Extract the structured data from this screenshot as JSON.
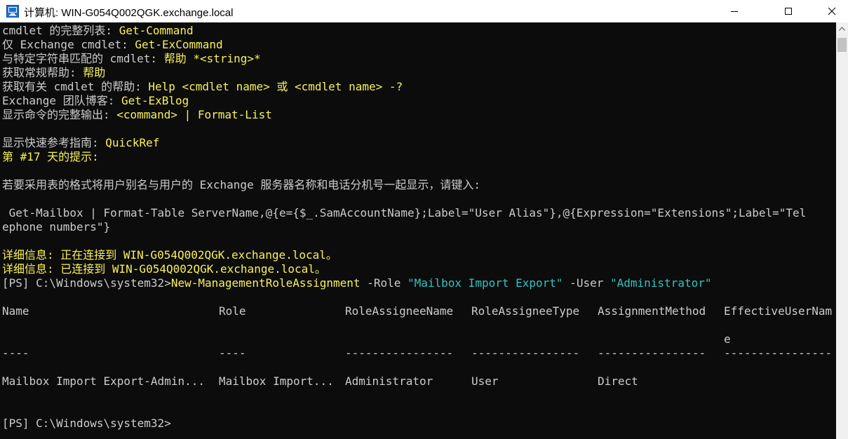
{
  "window": {
    "title": "计算机: WIN-G054Q002QGK.exchange.local",
    "minimize_icon": "minimize-icon",
    "maximize_icon": "maximize-icon",
    "close_icon": "close-icon"
  },
  "console": {
    "lines": [
      {
        "label": "cmdlet 的完整列表: ",
        "value": "Get-Command"
      },
      {
        "label": "仅 Exchange cmdlet: ",
        "value": "Get-ExCommand"
      },
      {
        "label": "与特定字符串匹配的 cmdlet: ",
        "value": "帮助 *<string>*"
      },
      {
        "label": "获取常规帮助: ",
        "value": "帮助"
      },
      {
        "label": "获取有关 cmdlet 的帮助: ",
        "value": "Help <cmdlet name> 或 <cmdlet name> -?"
      },
      {
        "label": "Exchange 团队博客: ",
        "value": "Get-ExBlog"
      },
      {
        "label": "显示命令的完整输出: ",
        "value": "<command> | Format-List"
      }
    ],
    "quickref_label": "显示快速参考指南: ",
    "quickref_value": "QuickRef",
    "tip_heading": "第 #17 天的提示:",
    "tip_text": "若要采用表的格式将用户别名与用户的 Exchange 服务器名称和电话分机号一起显示，请键入:",
    "tip_cmd_1": " Get-Mailbox | Format-Table ServerName,@{e={$_.SamAccountName};Label=\"User Alias\"},@{Expression=\"Extensions\";Label=\"Tel",
    "tip_cmd_2": "ephone numbers\"}",
    "verbose_1": "详细信息: 正在连接到 WIN-G054Q002QGK.exchange.local。",
    "verbose_2": "详细信息: 已连接到 WIN-G054Q002QGK.exchange.local。",
    "prompt": "[PS] C:\\Windows\\system32>",
    "cmd_name": "New-ManagementRoleAssignment",
    "param_role": " -Role ",
    "param_role_value": "\"Mailbox Import Export\"",
    "param_user": " -User ",
    "param_user_value": "\"Administrator\"",
    "table": {
      "headers": [
        "Name",
        "Role",
        "RoleAssigneeName",
        "RoleAssigneeType",
        "AssignmentMethod",
        "EffectiveUserNam"
      ],
      "header_wrap": "e",
      "dashes": [
        "----",
        "----",
        "----------------",
        "----------------",
        "----------------",
        "----------------"
      ],
      "row": [
        "Mailbox Import Export-Admin...",
        "Mailbox Import...",
        "Administrator",
        "User",
        "Direct",
        ""
      ]
    },
    "final_prompt": "[PS] C:\\Windows\\system32>"
  }
}
